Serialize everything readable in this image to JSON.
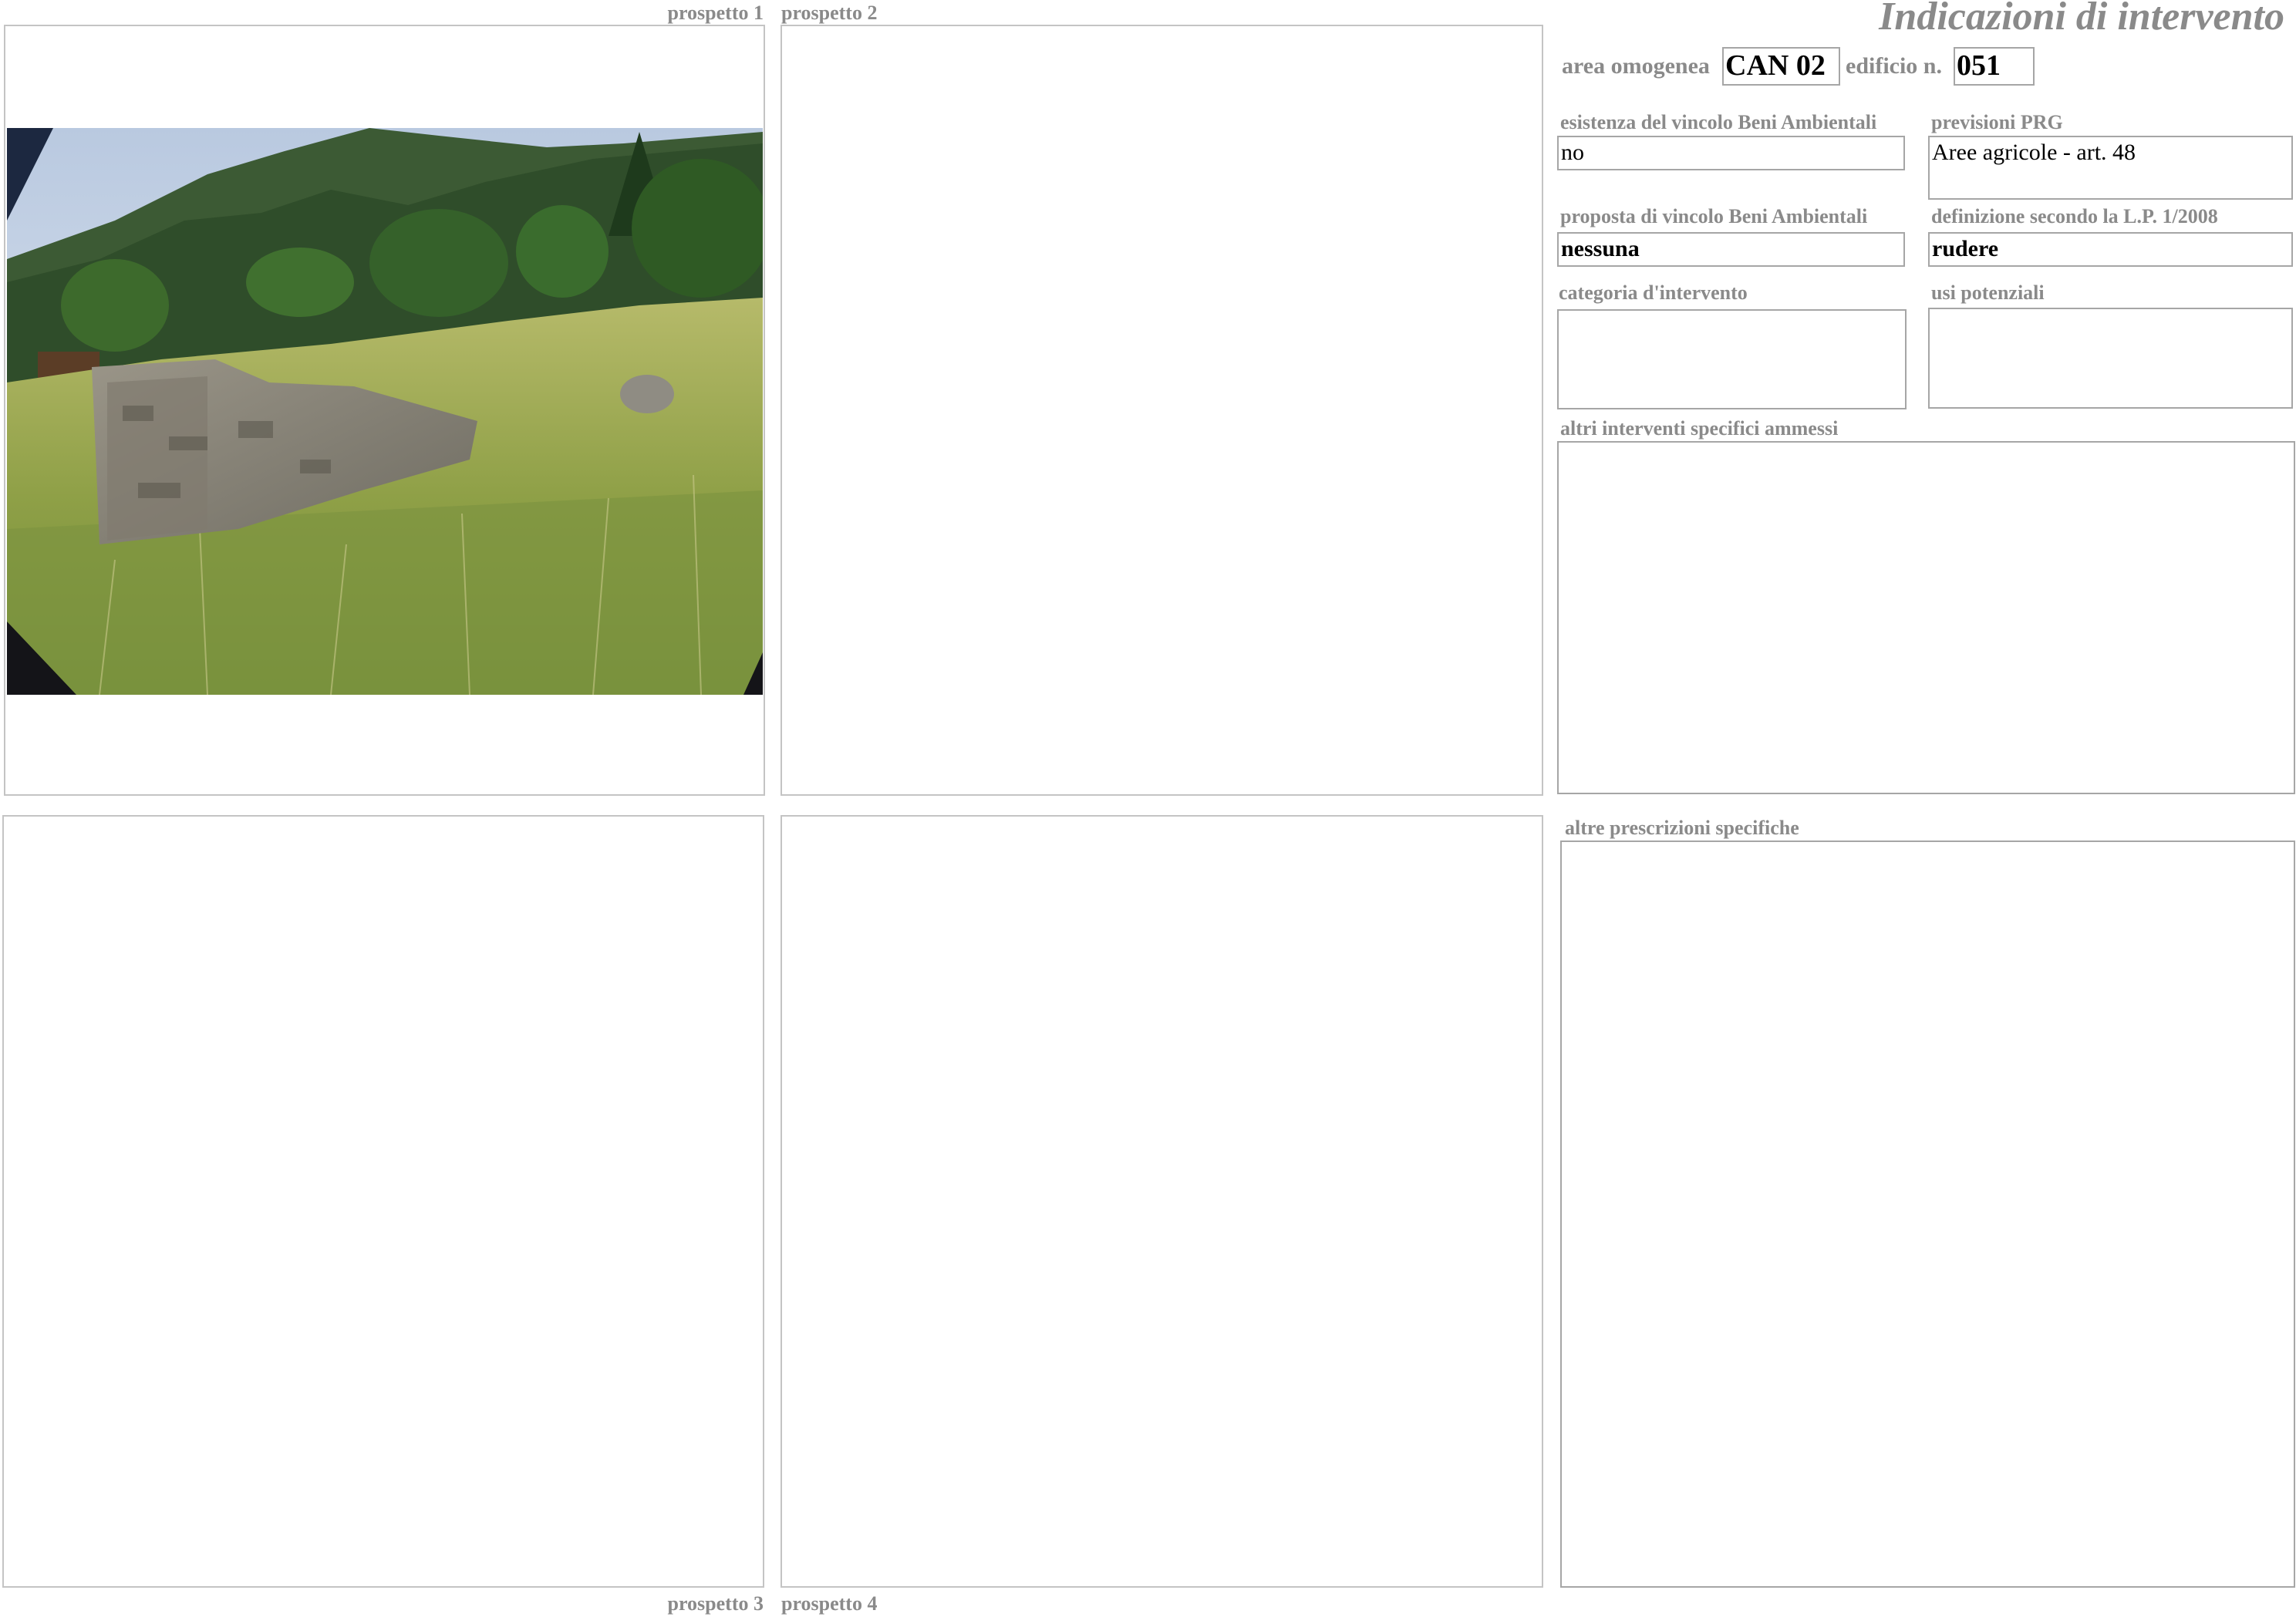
{
  "header": {
    "title": "Indicazioni di intervento",
    "area_label": "area omogenea",
    "area_value": "CAN 02",
    "building_label": "edificio n.",
    "building_value": "051"
  },
  "views": {
    "prospetto1": "prospetto 1",
    "prospetto2": "prospetto 2",
    "prospetto3": "prospetto 3",
    "prospetto4": "prospetto 4"
  },
  "fields": {
    "vincolo_esistenza": {
      "label": "esistenza del vincolo Beni Ambientali",
      "value": "no"
    },
    "previsioni_prg": {
      "label": "previsioni PRG",
      "value": "Aree agricole - art. 48"
    },
    "vincolo_proposta": {
      "label": "proposta di vincolo Beni Ambientali",
      "value": "nessuna"
    },
    "definizione_lp": {
      "label": "definizione secondo la L.P. 1/2008",
      "value": "rudere"
    },
    "categoria": {
      "label": "categoria d'intervento",
      "value": ""
    },
    "usi": {
      "label": "usi potenziali",
      "value": ""
    },
    "altri_interventi": {
      "label": "altri interventi specifici ammessi",
      "value": ""
    },
    "altre_prescrizioni": {
      "label": "altre prescrizioni specifiche",
      "value": ""
    }
  },
  "colors": {
    "label_gray": "#8a8a8a",
    "frame_border": "#c4c4c4",
    "field_border": "#a6a6a6"
  }
}
